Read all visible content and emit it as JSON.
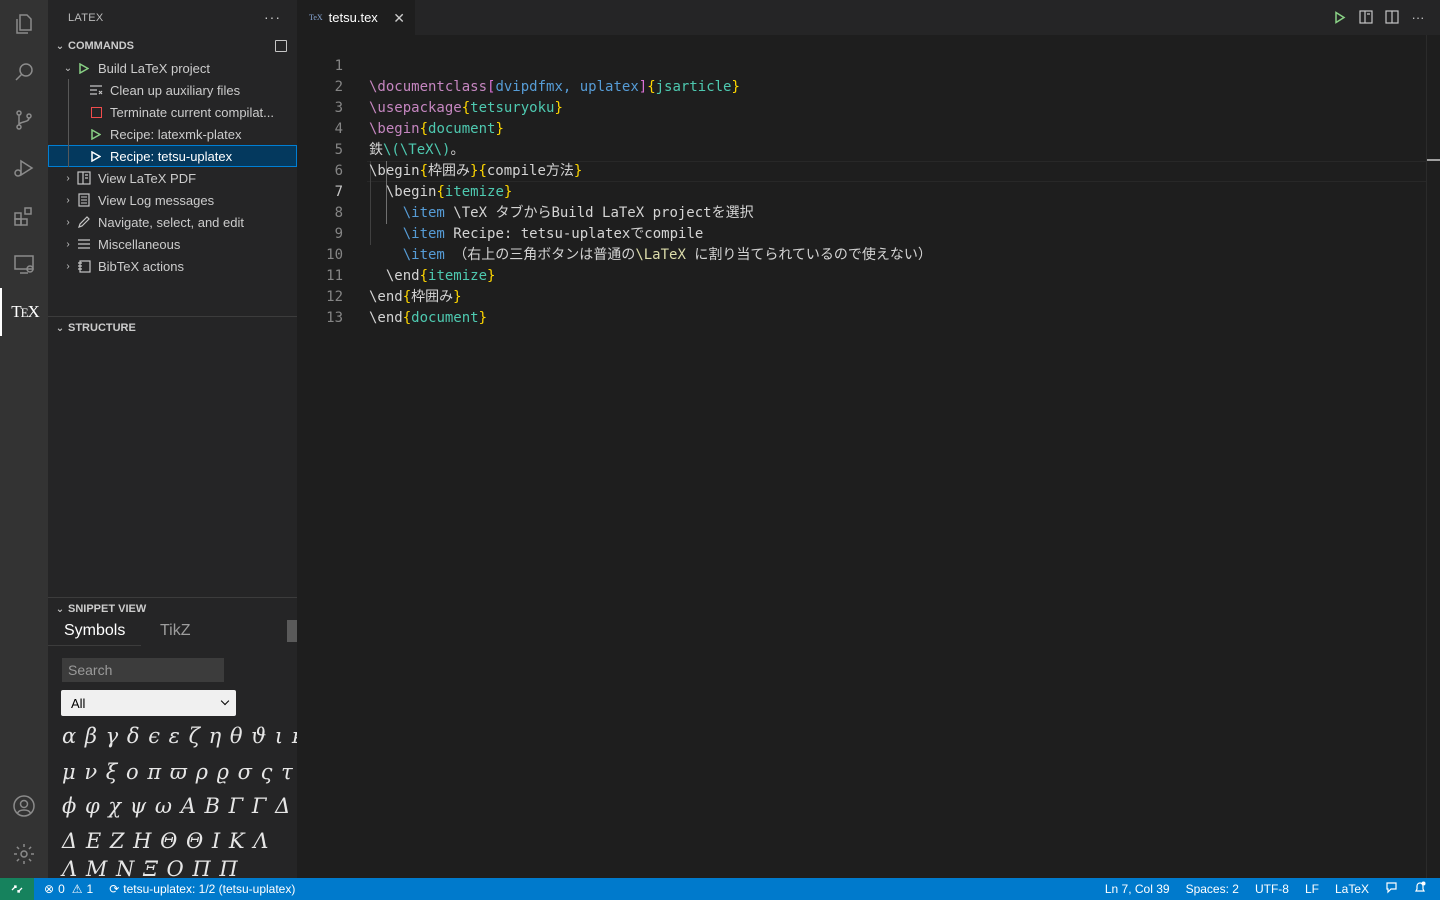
{
  "sidebar": {
    "title": "LATEX",
    "commands_header": "COMMANDS",
    "structure_header": "STRUCTURE",
    "snippet_header": "SNIPPET VIEW",
    "items": [
      {
        "label": "Build LaTeX project"
      },
      {
        "label": "Clean up auxiliary files"
      },
      {
        "label": "Terminate current compilat..."
      },
      {
        "label": "Recipe: latexmk-platex"
      },
      {
        "label": "Recipe: tetsu-uplatex"
      },
      {
        "label": "View LaTeX PDF"
      },
      {
        "label": "View Log messages"
      },
      {
        "label": "Navigate, select, and edit"
      },
      {
        "label": "Miscellaneous"
      },
      {
        "label": "BibTeX actions"
      }
    ],
    "snippet": {
      "tabs": [
        "Symbols",
        "TikZ"
      ],
      "search_placeholder": "Search",
      "filter_value": "All",
      "symbol_rows": [
        "α β γ δ ϵ ε ζ η θ ϑ ι κ λ",
        "μ ν ξ ο π ϖ ρ ϱ σ ς τ υ",
        "ϕ φ χ ψ ω A B Γ Γ Δ",
        "Δ E Z H Θ Θ I K Λ",
        "Λ M N Ξ O Π Π"
      ]
    }
  },
  "editor": {
    "tab_icon_text": "TeX",
    "tab_name": "tetsu.tex",
    "lines": [
      {
        "n": "1"
      },
      {
        "n": "2"
      },
      {
        "n": "3"
      },
      {
        "n": "4"
      },
      {
        "n": "5"
      },
      {
        "n": "6"
      },
      {
        "n": "7"
      },
      {
        "n": "8"
      },
      {
        "n": "9"
      },
      {
        "n": "10"
      },
      {
        "n": "11"
      },
      {
        "n": "12"
      },
      {
        "n": "13"
      }
    ],
    "code": {
      "l1_cmd": "\\documentclass",
      "l1_opt": "dvipdfmx, uplatex",
      "l1_arg": "jsarticle",
      "l2_cmd": "\\usepackage",
      "l2_arg": "tetsuryoku",
      "l3_cmd": "\\begin",
      "l3_arg": "document",
      "l4_a": "鉄",
      "l4_b": "\\(\\TeX\\)",
      "l4_c": "。",
      "l5_cmd": "\\begin",
      "l5_arg1": "枠囲み",
      "l5_arg2": "compile方法",
      "l6_cmd": "\\begin",
      "l6_arg": "itemize",
      "l7_cmd": "\\item",
      "l7_text": " \\TeX タブからBuild LaTeX projectを選択",
      "l8_cmd": "\\item",
      "l8_text": " Recipe: tetsu-uplatexでcompile",
      "l9_cmd": "\\item",
      "l9_text1": " （右上の三角ボタンは普通の",
      "l9_tex": "\\LaTeX",
      "l9_text2": " に割り当てられているので使えない）",
      "l10_cmd": "\\end",
      "l10_arg": "itemize",
      "l11_cmd": "\\end",
      "l11_arg": "枠囲み",
      "l12_cmd": "\\end",
      "l12_arg": "document"
    }
  },
  "status": {
    "errors": "0",
    "warnings": "1",
    "build": "tetsu-uplatex: 1/2 (tetsu-uplatex)",
    "position": "Ln 7, Col 39",
    "spaces": "Spaces: 2",
    "encoding": "UTF-8",
    "eol": "LF",
    "language": "LaTeX"
  },
  "colors": {
    "status_bar": "#007acc",
    "remote": "#16825d",
    "selection": "#04395e"
  }
}
